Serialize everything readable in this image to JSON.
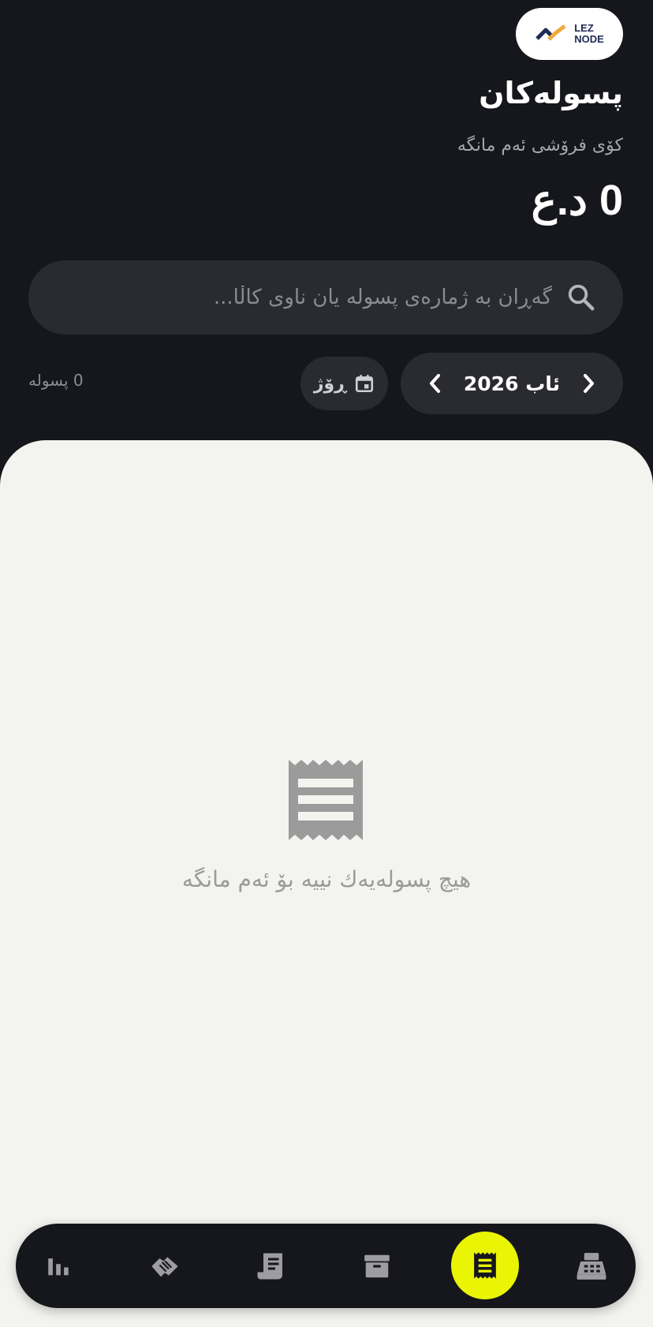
{
  "header": {
    "logo_line1": "LEZ",
    "logo_line2": "NODE",
    "title": "پسولەکان",
    "subtitle": "کۆی فرۆشی ئەم مانگە",
    "total": "0 د.ع"
  },
  "search": {
    "placeholder": "گەڕان بە ژمارەی پسولە یان ناوی کاڵا..."
  },
  "filters": {
    "month_label": "ئاب 2026",
    "day_label": "ڕۆژ",
    "count_label": "0 پسولە"
  },
  "empty_state": {
    "message": "هیچ پسولەیەك نییە بۆ ئەم مانگە"
  },
  "bottom_nav": {
    "items": [
      "bar-chart-icon",
      "handshake-icon",
      "receipt-long-icon",
      "archive-icon",
      "receipt-icon",
      "cash-register-icon"
    ],
    "active": "receipt-icon"
  },
  "colors": {
    "dark_bg": "#16171c",
    "card_bg": "#2a2b31",
    "content_bg": "#f3f3ef",
    "accent": "#e9f505"
  }
}
